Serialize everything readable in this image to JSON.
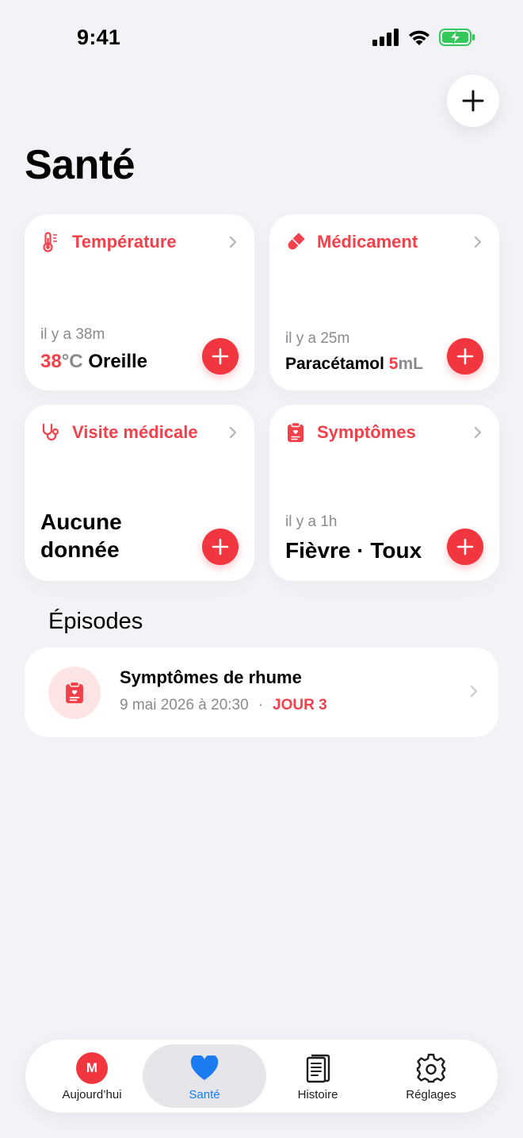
{
  "status_bar": {
    "time": "9:41"
  },
  "page": {
    "title": "Santé"
  },
  "cards": {
    "temperature": {
      "title": "Température",
      "time_ago": "il y a 38m",
      "value": "38",
      "unit": "°C",
      "location": "Oreille"
    },
    "medication": {
      "title": "Médicament",
      "time_ago": "il y a 25m",
      "name": "Paracétamol",
      "dose": "5",
      "unit": "mL"
    },
    "visit": {
      "title": "Visite médicale",
      "empty_line1": "Aucune",
      "empty_line2": "donnée"
    },
    "symptoms": {
      "title": "Symptômes",
      "time_ago": "il y a 1h",
      "value": "Fièvre · Toux"
    }
  },
  "episodes": {
    "section_title": "Épisodes",
    "items": [
      {
        "title": "Symptômes de rhume",
        "date": "9 mai 2026 à 20:30",
        "separator": "·",
        "badge": "JOUR 3"
      }
    ]
  },
  "tab_bar": {
    "tabs": [
      {
        "label": "Aujourd’hui",
        "avatar_letter": "M",
        "icon": "avatar"
      },
      {
        "label": "Santé",
        "icon": "heart-icon",
        "active": true
      },
      {
        "label": "Histoire",
        "icon": "journal-icon"
      },
      {
        "label": "Réglages",
        "icon": "gear-icon"
      }
    ]
  },
  "colors": {
    "accent": "#F2414A",
    "add_button": "#F2363F",
    "active_tab": "#1A7CF0",
    "background": "#F2F2F7"
  }
}
